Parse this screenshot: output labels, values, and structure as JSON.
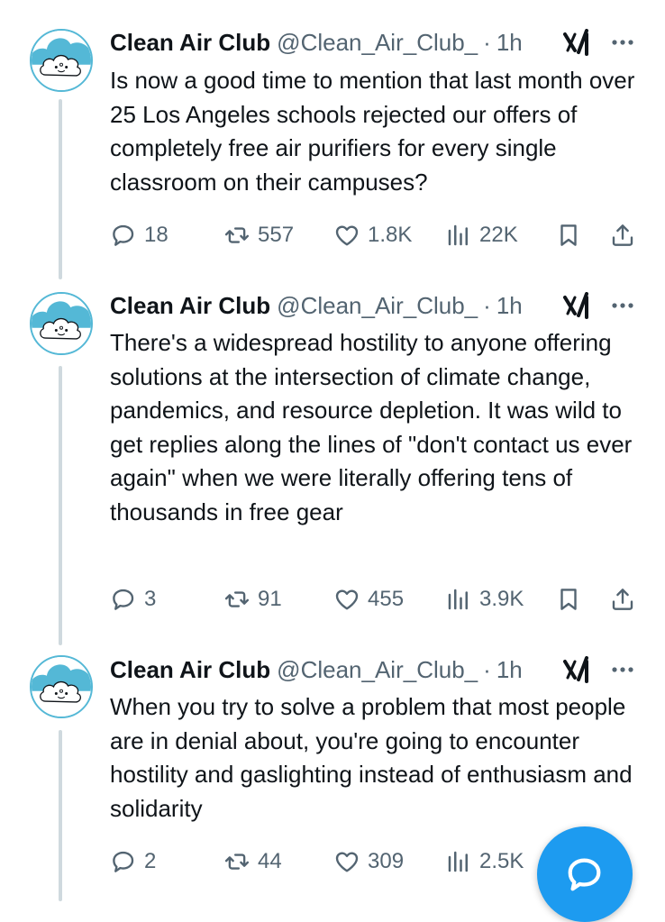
{
  "tweets": [
    {
      "author_name": "Clean Air Club",
      "author_handle": "@Clean_Air_Club_",
      "separator": "·",
      "time": "1h",
      "avatar_label": "CLEAN AIR CLUB",
      "text": "Is now a good time to mention that last month over 25 Los Angeles schools rejected our offers of completely free air purifiers for every single classroom on their campuses?",
      "replies": "18",
      "reposts": "557",
      "likes": "1.8K",
      "views": "22K"
    },
    {
      "author_name": "Clean Air Club",
      "author_handle": "@Clean_Air_Club_",
      "separator": "·",
      "time": "1h",
      "avatar_label": "CLEAN AIR CLUB",
      "text": "There's a widespread hostility to anyone offering solutions at the intersection of climate change, pandemics, and resource depletion. It was wild to get replies along the lines of \"don't contact us ever again\" when we were literally offering tens of thousands in free gear",
      "replies": "3",
      "reposts": "91",
      "likes": "455",
      "views": "3.9K"
    },
    {
      "author_name": "Clean Air Club",
      "author_handle": "@Clean_Air_Club_",
      "separator": "·",
      "time": "1h",
      "avatar_label": "CLEAN AIR CLUB",
      "text": "When you try to solve a problem that most people are in denial about, you're going to encounter hostility and gaslighting instead of enthusiasm and solidarity",
      "replies": "2",
      "reposts": "44",
      "likes": "309",
      "views": "2.5K"
    }
  ],
  "icons": {
    "reply": "speech-bubble-icon",
    "repost": "repost-arrows-icon",
    "like": "heart-icon",
    "views": "bar-chart-icon",
    "bookmark": "bookmark-icon",
    "share": "share-upload-icon",
    "grok": "grok-slash-icon",
    "more": "three-dots-icon",
    "compose": "compose-reply-icon"
  },
  "colors": {
    "accent": "#1d9bf0",
    "text_primary": "#0f1419",
    "text_secondary": "#536471",
    "thread_line": "#cfd9de",
    "avatar_cloud": "#54b8d6"
  }
}
